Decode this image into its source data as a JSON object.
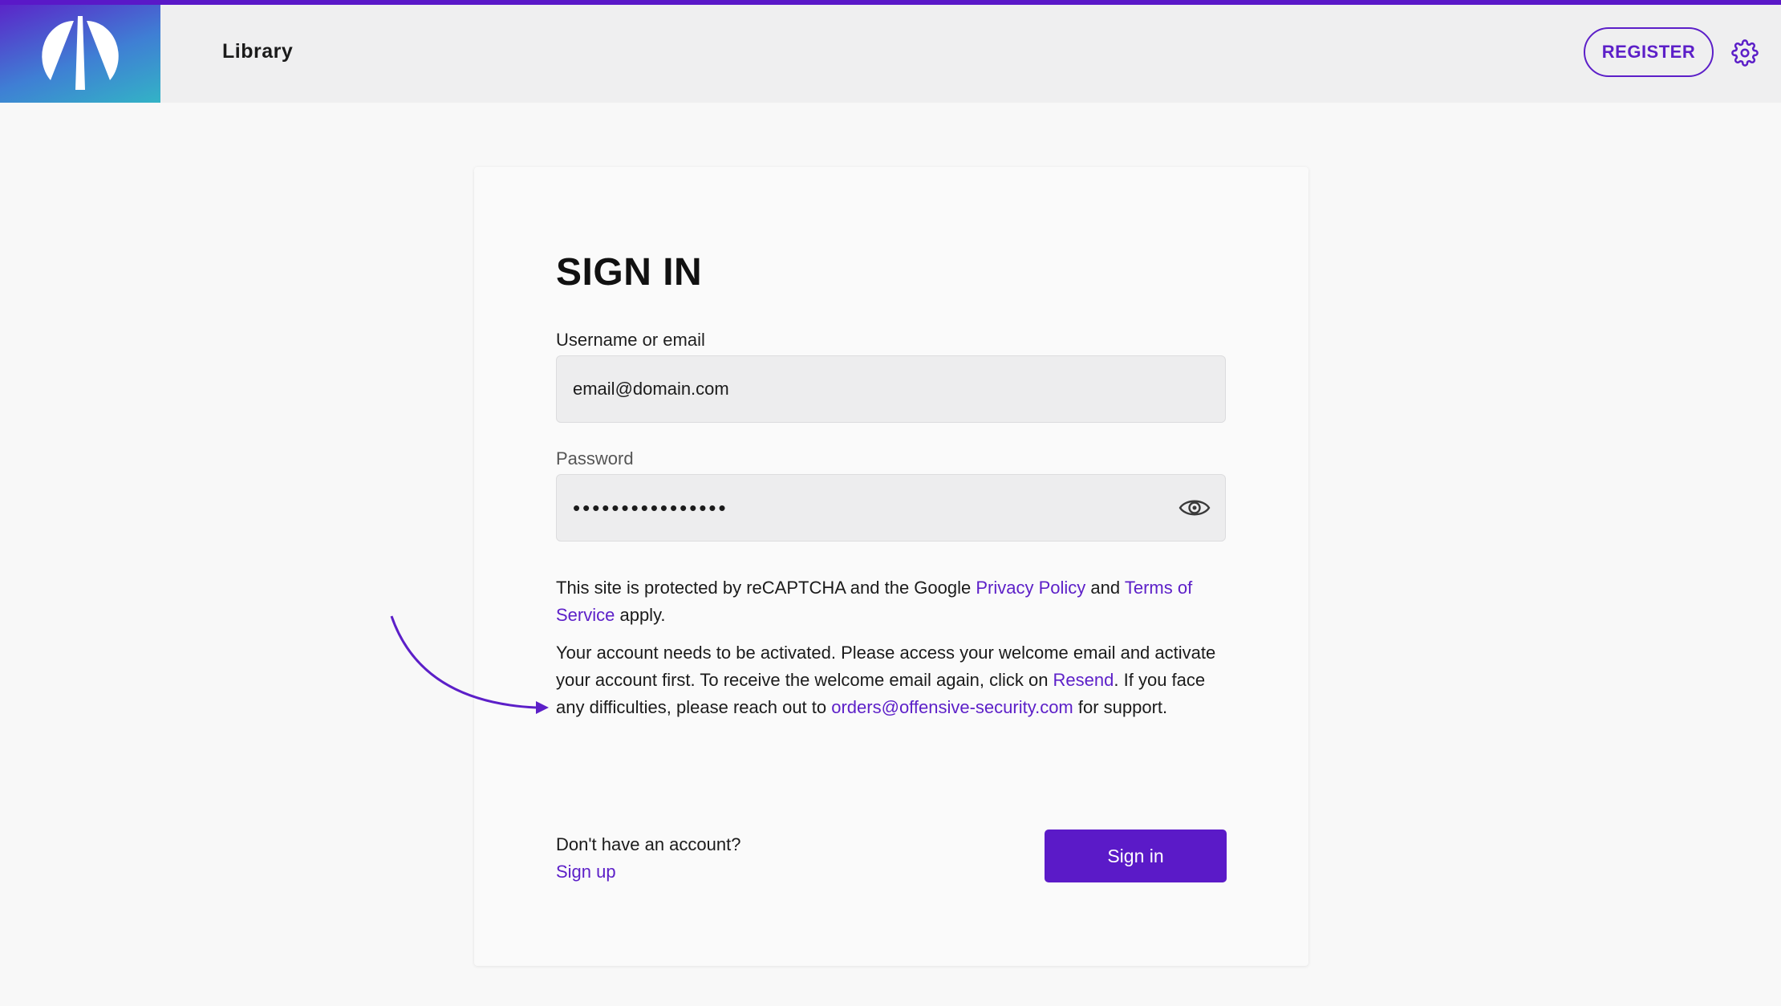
{
  "header": {
    "title": "Library",
    "register_label": "REGISTER",
    "logo_icon": "logo-icon",
    "settings_icon": "gear-icon"
  },
  "colors": {
    "accent": "#5c1fc8",
    "header_bg": "#efeff0",
    "page_bg": "#f8f8f8",
    "input_bg": "#ededee",
    "arrow": "#5c1fc8"
  },
  "signin": {
    "title": "SIGN IN",
    "username_label": "Username or email",
    "username_value": "email@domain.com",
    "password_label": "Password",
    "password_value": "••••••••••••••••",
    "show_password_icon": "eye-icon",
    "recaptcha": {
      "prefix": "This site is protected by reCAPTCHA and the Google ",
      "privacy_link": "Privacy Policy",
      "middle": " and ",
      "terms_link": "Terms of Service",
      "suffix": " apply."
    },
    "activation": {
      "text1": "Your account needs to be activated. Please access your welcome email and activate your account first. To receive the welcome email again, click on ",
      "resend_link": "Resend",
      "text2": ". If you face any difficulties, please reach out to ",
      "email_link": "orders@offensive-security.com",
      "text3": " for support."
    },
    "annotation_icon": "arrow-icon",
    "no_account_text": "Don't have an account?",
    "signup_link": "Sign up",
    "submit_label": "Sign in"
  }
}
